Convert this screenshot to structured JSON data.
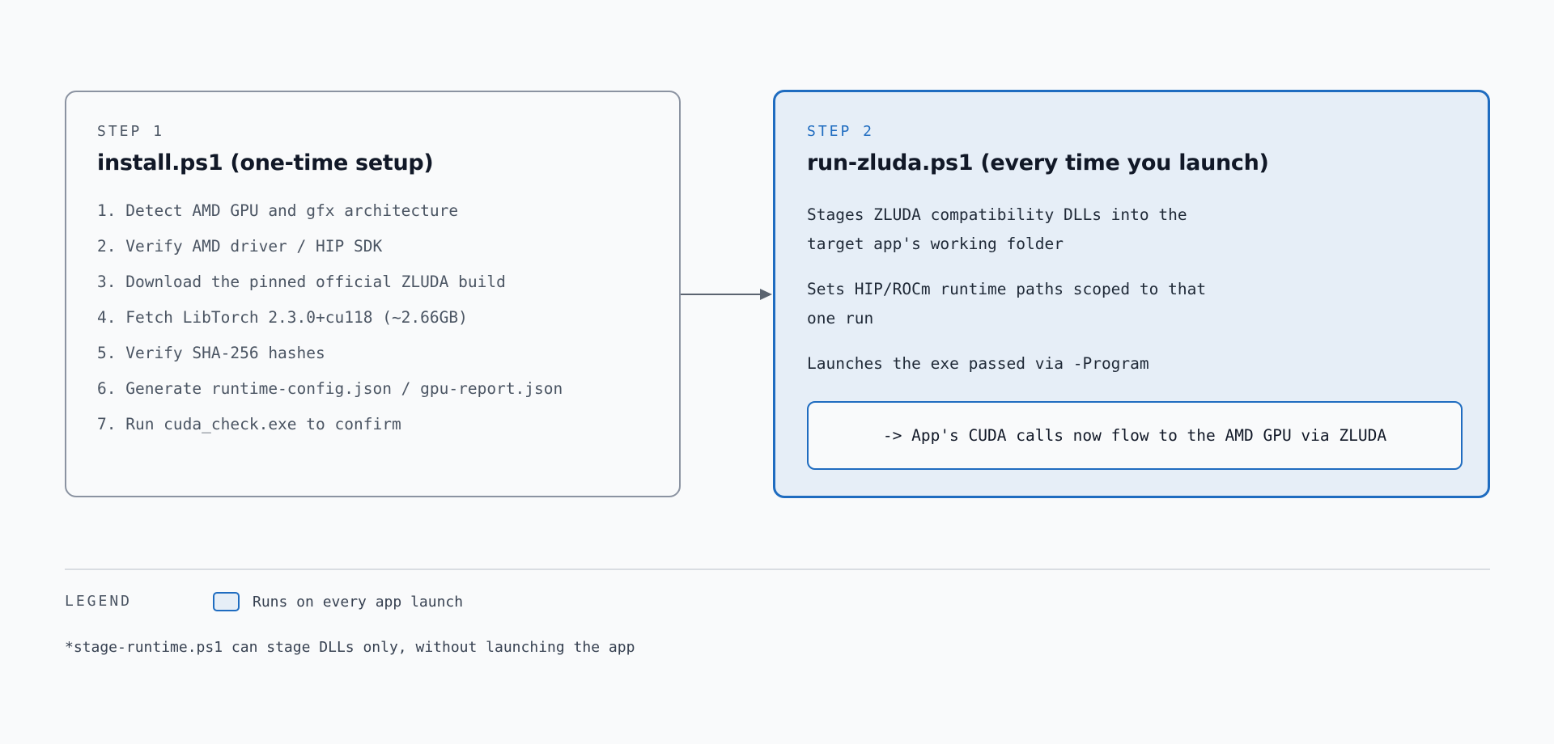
{
  "step1": {
    "label": "STEP 1",
    "title": "install.ps1 (one-time setup)",
    "items": [
      "1. Detect AMD GPU and gfx architecture",
      "2. Verify AMD driver / HIP SDK",
      "3. Download the pinned official ZLUDA build",
      "4. Fetch LibTorch 2.3.0+cu118 (~2.66GB)",
      "5. Verify SHA-256 hashes",
      "6. Generate runtime-config.json / gpu-report.json",
      "7. Run cuda_check.exe to confirm"
    ]
  },
  "step2": {
    "label": "STEP 2",
    "title": "run-zluda.ps1 (every time you launch)",
    "items": [
      "Stages ZLUDA compatibility DLLs into the target app's working folder",
      "Sets HIP/ROCm runtime paths scoped to that one run",
      "Launches the exe passed via -Program"
    ],
    "result": "-> App's CUDA calls now flow to the AMD GPU via ZLUDA"
  },
  "legend": {
    "title": "LEGEND",
    "entry": "Runs on every app launch"
  },
  "footnote": "*stage-runtime.ps1 can stage DLLs only, without launching the app",
  "colors": {
    "accent": "#1f6cc0",
    "accent_fill": "#e6eef7",
    "neutral_border": "#8b93a1",
    "background": "#f9fafb"
  }
}
